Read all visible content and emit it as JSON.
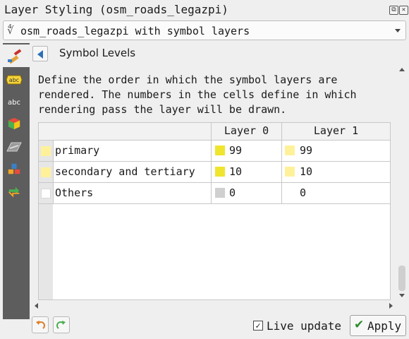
{
  "window": {
    "title": "Layer Styling (osm_roads_legazpi)",
    "float_button": "⧉",
    "close_button": "✕"
  },
  "renderer": {
    "icon": "∜",
    "label": "osm_roads_legazpi with symbol layers"
  },
  "sidebar": {
    "items": [
      {
        "icon": "paintbrush-icon"
      },
      {
        "icon": "labels-icon"
      },
      {
        "icon": "text-abc-icon"
      },
      {
        "icon": "3d-cube-icon"
      },
      {
        "icon": "diagram-icon"
      },
      {
        "icon": "layers-icon"
      },
      {
        "icon": "history-icon"
      }
    ]
  },
  "section": {
    "title": "Symbol Levels"
  },
  "description": "Define the order in which the symbol layers are\nrendered. The numbers in the cells define in which\nrendering pass the layer will be drawn.",
  "table": {
    "columns": [
      "Layer 0",
      "Layer 1"
    ],
    "rows": [
      {
        "name": "primary",
        "row_color": "#fff19a",
        "cells": [
          {
            "value": "99",
            "color": "#f0e52e"
          },
          {
            "value": "99",
            "color": "#fff19a"
          }
        ]
      },
      {
        "name": "secondary and tertiary",
        "row_color": "#fff19a",
        "cells": [
          {
            "value": "10",
            "color": "#f0e52e"
          },
          {
            "value": "10",
            "color": "#fff19a"
          }
        ]
      },
      {
        "name": "Others",
        "row_color": "#ffffff",
        "cells": [
          {
            "value": "0",
            "color": "#d0d0d0"
          },
          {
            "value": "0",
            "color": "transparent"
          }
        ]
      }
    ]
  },
  "footer": {
    "live_update_label": "Live update",
    "live_update_checked": true,
    "check_mark": "✓",
    "apply_label": "Apply",
    "apply_icon": "✔"
  }
}
